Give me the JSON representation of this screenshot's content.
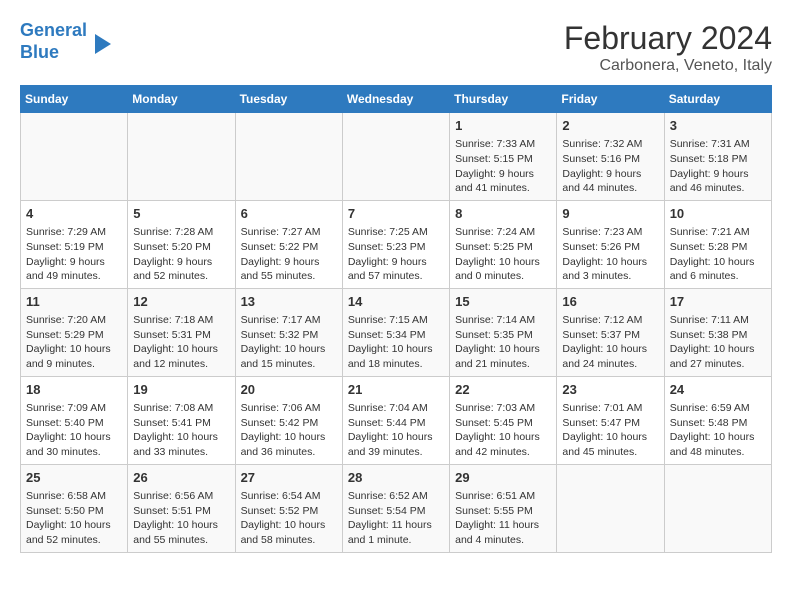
{
  "header": {
    "logo_line1": "General",
    "logo_line2": "Blue",
    "title": "February 2024",
    "subtitle": "Carbonera, Veneto, Italy"
  },
  "days_of_week": [
    "Sunday",
    "Monday",
    "Tuesday",
    "Wednesday",
    "Thursday",
    "Friday",
    "Saturday"
  ],
  "weeks": [
    [
      {
        "day": "",
        "info": ""
      },
      {
        "day": "",
        "info": ""
      },
      {
        "day": "",
        "info": ""
      },
      {
        "day": "",
        "info": ""
      },
      {
        "day": "1",
        "info": "Sunrise: 7:33 AM\nSunset: 5:15 PM\nDaylight: 9 hours\nand 41 minutes."
      },
      {
        "day": "2",
        "info": "Sunrise: 7:32 AM\nSunset: 5:16 PM\nDaylight: 9 hours\nand 44 minutes."
      },
      {
        "day": "3",
        "info": "Sunrise: 7:31 AM\nSunset: 5:18 PM\nDaylight: 9 hours\nand 46 minutes."
      }
    ],
    [
      {
        "day": "4",
        "info": "Sunrise: 7:29 AM\nSunset: 5:19 PM\nDaylight: 9 hours\nand 49 minutes."
      },
      {
        "day": "5",
        "info": "Sunrise: 7:28 AM\nSunset: 5:20 PM\nDaylight: 9 hours\nand 52 minutes."
      },
      {
        "day": "6",
        "info": "Sunrise: 7:27 AM\nSunset: 5:22 PM\nDaylight: 9 hours\nand 55 minutes."
      },
      {
        "day": "7",
        "info": "Sunrise: 7:25 AM\nSunset: 5:23 PM\nDaylight: 9 hours\nand 57 minutes."
      },
      {
        "day": "8",
        "info": "Sunrise: 7:24 AM\nSunset: 5:25 PM\nDaylight: 10 hours\nand 0 minutes."
      },
      {
        "day": "9",
        "info": "Sunrise: 7:23 AM\nSunset: 5:26 PM\nDaylight: 10 hours\nand 3 minutes."
      },
      {
        "day": "10",
        "info": "Sunrise: 7:21 AM\nSunset: 5:28 PM\nDaylight: 10 hours\nand 6 minutes."
      }
    ],
    [
      {
        "day": "11",
        "info": "Sunrise: 7:20 AM\nSunset: 5:29 PM\nDaylight: 10 hours\nand 9 minutes."
      },
      {
        "day": "12",
        "info": "Sunrise: 7:18 AM\nSunset: 5:31 PM\nDaylight: 10 hours\nand 12 minutes."
      },
      {
        "day": "13",
        "info": "Sunrise: 7:17 AM\nSunset: 5:32 PM\nDaylight: 10 hours\nand 15 minutes."
      },
      {
        "day": "14",
        "info": "Sunrise: 7:15 AM\nSunset: 5:34 PM\nDaylight: 10 hours\nand 18 minutes."
      },
      {
        "day": "15",
        "info": "Sunrise: 7:14 AM\nSunset: 5:35 PM\nDaylight: 10 hours\nand 21 minutes."
      },
      {
        "day": "16",
        "info": "Sunrise: 7:12 AM\nSunset: 5:37 PM\nDaylight: 10 hours\nand 24 minutes."
      },
      {
        "day": "17",
        "info": "Sunrise: 7:11 AM\nSunset: 5:38 PM\nDaylight: 10 hours\nand 27 minutes."
      }
    ],
    [
      {
        "day": "18",
        "info": "Sunrise: 7:09 AM\nSunset: 5:40 PM\nDaylight: 10 hours\nand 30 minutes."
      },
      {
        "day": "19",
        "info": "Sunrise: 7:08 AM\nSunset: 5:41 PM\nDaylight: 10 hours\nand 33 minutes."
      },
      {
        "day": "20",
        "info": "Sunrise: 7:06 AM\nSunset: 5:42 PM\nDaylight: 10 hours\nand 36 minutes."
      },
      {
        "day": "21",
        "info": "Sunrise: 7:04 AM\nSunset: 5:44 PM\nDaylight: 10 hours\nand 39 minutes."
      },
      {
        "day": "22",
        "info": "Sunrise: 7:03 AM\nSunset: 5:45 PM\nDaylight: 10 hours\nand 42 minutes."
      },
      {
        "day": "23",
        "info": "Sunrise: 7:01 AM\nSunset: 5:47 PM\nDaylight: 10 hours\nand 45 minutes."
      },
      {
        "day": "24",
        "info": "Sunrise: 6:59 AM\nSunset: 5:48 PM\nDaylight: 10 hours\nand 48 minutes."
      }
    ],
    [
      {
        "day": "25",
        "info": "Sunrise: 6:58 AM\nSunset: 5:50 PM\nDaylight: 10 hours\nand 52 minutes."
      },
      {
        "day": "26",
        "info": "Sunrise: 6:56 AM\nSunset: 5:51 PM\nDaylight: 10 hours\nand 55 minutes."
      },
      {
        "day": "27",
        "info": "Sunrise: 6:54 AM\nSunset: 5:52 PM\nDaylight: 10 hours\nand 58 minutes."
      },
      {
        "day": "28",
        "info": "Sunrise: 6:52 AM\nSunset: 5:54 PM\nDaylight: 11 hours\nand 1 minute."
      },
      {
        "day": "29",
        "info": "Sunrise: 6:51 AM\nSunset: 5:55 PM\nDaylight: 11 hours\nand 4 minutes."
      },
      {
        "day": "",
        "info": ""
      },
      {
        "day": "",
        "info": ""
      }
    ]
  ]
}
